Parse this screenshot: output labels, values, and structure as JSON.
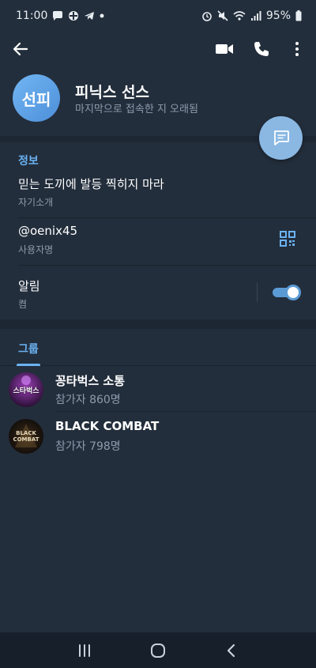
{
  "status_bar": {
    "time": "11:00",
    "battery": "95%",
    "left_icons": [
      "message-icon",
      "cross-icon",
      "telegram-icon",
      "dot-icon"
    ],
    "right_icons": [
      "alarm-icon",
      "mute-icon",
      "wifi-icon",
      "signal-icon",
      "battery-icon"
    ]
  },
  "header": {
    "back_icon": "arrow-left-icon",
    "actions": [
      "video-call-icon",
      "phone-call-icon",
      "more-vert-icon"
    ],
    "avatar_initials": "선피",
    "name": "피닉스 선스",
    "last_seen": "마지막으로 접속한 지 오래됨",
    "fab_icon": "message-icon"
  },
  "info": {
    "section_title": "정보",
    "bio": {
      "value": "믿는 도끼에 발등 찍히지 마라",
      "label": "자기소개"
    },
    "username": {
      "value": "@oenix45",
      "label": "사용자명",
      "action_icon": "qr-code-icon"
    },
    "notifications": {
      "value": "알림",
      "label": "켬",
      "enabled": true
    }
  },
  "groups": {
    "tab_label": "그룹",
    "items": [
      {
        "name": "꽁타벅스 소통",
        "members": "참가자 860명",
        "avatar_text": "스타벅스"
      },
      {
        "name": "BLACK COMBAT",
        "members": "참가자 798명",
        "avatar_text": "BLACK COMBAT"
      }
    ]
  },
  "nav_bar": {
    "buttons": [
      "recent-apps-icon",
      "home-icon",
      "back-icon"
    ]
  },
  "colors": {
    "background": "#1d2733",
    "surface": "#232e3c",
    "accent": "#6ab2f2",
    "avatar": "#5a9be0",
    "fab": "#8ab8e3",
    "secondary_text": "#8d9bab"
  }
}
